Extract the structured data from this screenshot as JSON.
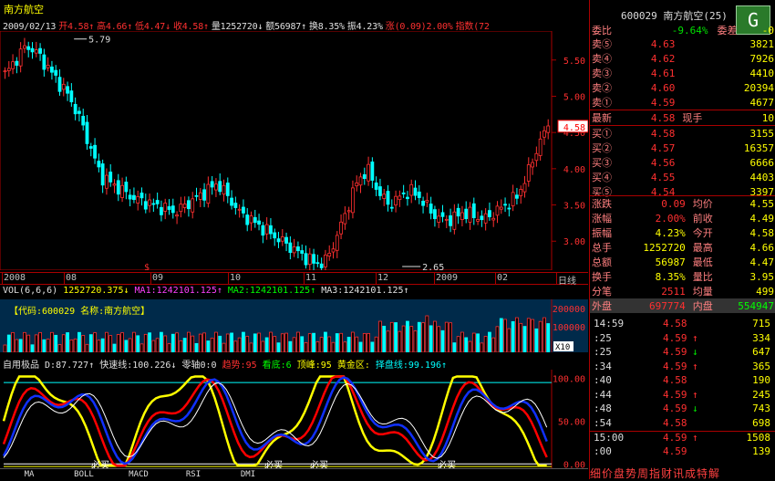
{
  "stock": {
    "name": "南方航空",
    "code": "600029",
    "code_label": "600029 南方航空(25)"
  },
  "info": {
    "date": "2009/02/13",
    "open": "开4.58↑",
    "high": "高4.66↑",
    "low": "低4.47↓",
    "close": "收4.58↑",
    "vol": "量1252720↓",
    "amt": "额56987↑",
    "turn": "换8.35%",
    "amp": "振4.23%",
    "chg": "涨(0.09)2.00%",
    "idx": "指数(72"
  },
  "price_ticks": [
    "5.50",
    "5.00",
    "4.50",
    "4.00",
    "3.50",
    "3.00"
  ],
  "price_tag": "4.58",
  "hi_label": "5.79",
  "lo_label": "2.65",
  "xaxis": [
    "2008",
    "08",
    "09",
    "10",
    "11",
    "12",
    "2009",
    "02",
    "日线"
  ],
  "vol_bar": {
    "name": "VOL(6,6,6)",
    "v": "1252720.375↓",
    "ma1": "MA1:1242101.125↑",
    "ma2": "MA2:1242101.125↑",
    "ma3": "MA3:1242101.125↑"
  },
  "vol_axis": [
    "200000",
    "100000"
  ],
  "vol_tag": "【代码:600029 名称:南方航空】",
  "vol_unit": "X10",
  "kd_bar": {
    "name": "自用极品",
    "d": "D:87.727↑",
    "fast": "快速线:100.226↓",
    "zero": "零轴0:0",
    "trend": "趋势:95",
    "watch": "看底:6",
    "top": "顶峰:95",
    "gold": "黄金区:",
    "buy": "择盘线:99.196↑"
  },
  "kd_axis": [
    "100.00",
    "50.00",
    "0.00"
  ],
  "kd_labels": [
    "必买",
    "必买",
    "必买",
    "必买"
  ],
  "tabs": [
    "MA",
    "BOLL",
    "MACD",
    "RSI",
    "DMI"
  ],
  "panel": {
    "wei": "委比",
    "wei_v": "-9.64%",
    "wei_c": "委差",
    "wei_cv": "-0"
  },
  "asks": [
    {
      "l": "卖⑤",
      "p": "4.63",
      "v": "3821"
    },
    {
      "l": "卖④",
      "p": "4.62",
      "v": "7926"
    },
    {
      "l": "卖③",
      "p": "4.61",
      "v": "4410"
    },
    {
      "l": "卖②",
      "p": "4.60",
      "v": "20394"
    },
    {
      "l": "卖①",
      "p": "4.59",
      "v": "4677"
    }
  ],
  "last": {
    "l": "最新",
    "p": "4.58",
    "l2": "现手",
    "v": "10"
  },
  "bids": [
    {
      "l": "买①",
      "p": "4.58",
      "v": "3155"
    },
    {
      "l": "买②",
      "p": "4.57",
      "v": "16357"
    },
    {
      "l": "买③",
      "p": "4.56",
      "v": "6666"
    },
    {
      "l": "买④",
      "p": "4.55",
      "v": "4403"
    },
    {
      "l": "买⑤",
      "p": "4.54",
      "v": "3397"
    }
  ],
  "quote": [
    {
      "l": "涨跌",
      "v": "0.09",
      "l2": "均价",
      "v2": "4.55"
    },
    {
      "l": "涨幅",
      "v": "2.00%",
      "l2": "前收",
      "v2": "4.49"
    },
    {
      "l": "振幅",
      "v": "4.23%",
      "l2": "今开",
      "v2": "4.58"
    },
    {
      "l": "总手",
      "v": "1252720",
      "l2": "最高",
      "v2": "4.66"
    },
    {
      "l": "总额",
      "v": "56987",
      "l2": "最低",
      "v2": "4.47"
    },
    {
      "l": "换手",
      "v": "8.35%",
      "l2": "量比",
      "v2": "3.95"
    },
    {
      "l": "分笔",
      "v": "2511",
      "l2": "均量",
      "v2": "499"
    },
    {
      "l": "外盘",
      "v": "697774",
      "l2": "内盘",
      "v2": "554947"
    }
  ],
  "ticks": [
    {
      "t": "14:59",
      "p": "4.58",
      "a": "",
      "v": "715"
    },
    {
      "t": ":25",
      "p": "4.59",
      "a": "↑",
      "v": "334"
    },
    {
      "t": ":25",
      "p": "4.59",
      "a": "↓",
      "v": "647"
    },
    {
      "t": ":34",
      "p": "4.59",
      "a": "↑",
      "v": "365"
    },
    {
      "t": ":40",
      "p": "4.58",
      "a": "",
      "v": "190"
    },
    {
      "t": ":44",
      "p": "4.59",
      "a": "↑",
      "v": "245"
    },
    {
      "t": ":48",
      "p": "4.59",
      "a": "↓",
      "v": "743"
    },
    {
      "t": ":54",
      "p": "4.58",
      "a": "",
      "v": "698"
    },
    {
      "t": "15:00",
      "p": "4.59",
      "a": "↑",
      "v": "1508"
    },
    {
      "t": ":00",
      "p": "4.59",
      "a": "",
      "v": "139"
    }
  ],
  "bottom_tabs": "细价盘势周指财讯成特解"
}
